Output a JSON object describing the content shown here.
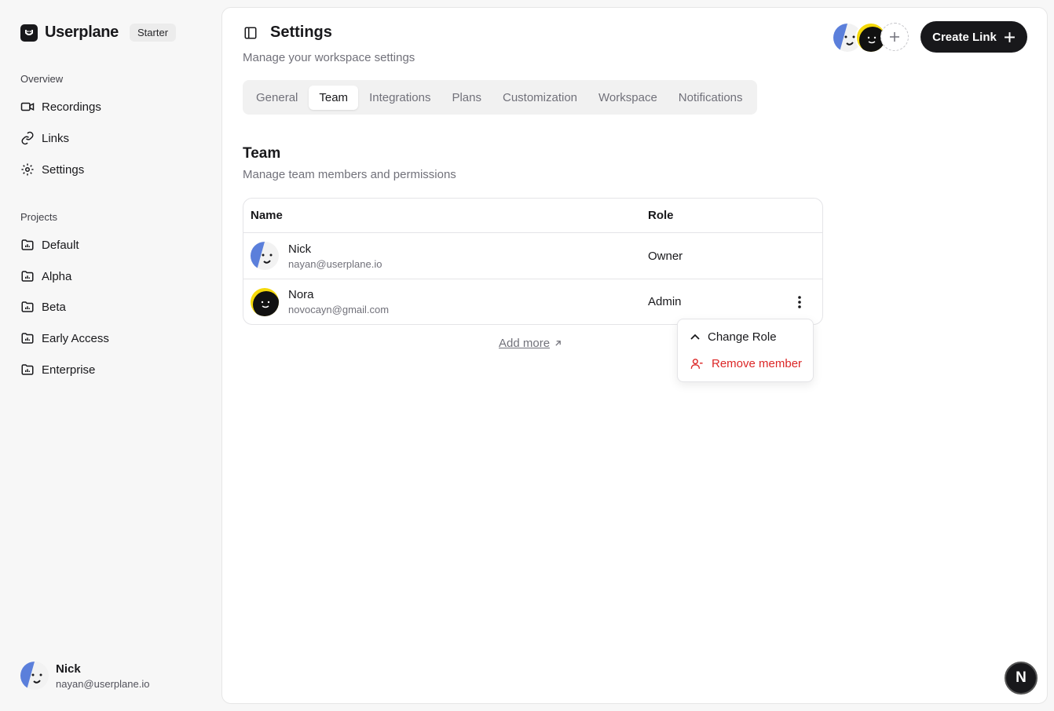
{
  "brand": {
    "name": "Userplane",
    "plan": "Starter"
  },
  "sidebar": {
    "overview_label": "Overview",
    "overview_items": [
      {
        "label": "Recordings",
        "icon": "video-icon"
      },
      {
        "label": "Links",
        "icon": "link-icon"
      },
      {
        "label": "Settings",
        "icon": "gear-icon"
      }
    ],
    "projects_label": "Projects",
    "projects": [
      {
        "label": "Default",
        "icon": "folder-chart-icon"
      },
      {
        "label": "Alpha",
        "icon": "folder-chart-icon"
      },
      {
        "label": "Beta",
        "icon": "folder-chart-icon"
      },
      {
        "label": "Early Access",
        "icon": "folder-chart-icon"
      },
      {
        "label": "Enterprise",
        "icon": "folder-chart-icon"
      }
    ],
    "user": {
      "name": "Nick",
      "email": "nayan@userplane.io"
    }
  },
  "header": {
    "title": "Settings",
    "subtitle": "Manage your workspace settings",
    "create_label": "Create Link"
  },
  "tabs": [
    {
      "label": "General",
      "active": false
    },
    {
      "label": "Team",
      "active": true
    },
    {
      "label": "Integrations",
      "active": false
    },
    {
      "label": "Plans",
      "active": false
    },
    {
      "label": "Customization",
      "active": false
    },
    {
      "label": "Workspace",
      "active": false
    },
    {
      "label": "Notifications",
      "active": false
    }
  ],
  "team": {
    "title": "Team",
    "subtitle": "Manage team members and permissions",
    "columns": {
      "name": "Name",
      "role": "Role"
    },
    "members": [
      {
        "name": "Nick",
        "email": "nayan@userplane.io",
        "role": "Owner"
      },
      {
        "name": "Nora",
        "email": "novocayn@gmail.com",
        "role": "Admin"
      }
    ],
    "add_more": "Add more"
  },
  "menu": {
    "change_role": "Change Role",
    "remove_member": "Remove member"
  },
  "colors": {
    "accent": "#18181b",
    "danger": "#dc2626",
    "avatar_blue": "#5b7fdb",
    "avatar_yellow": "#f5d90a"
  },
  "dev_badge": "N"
}
